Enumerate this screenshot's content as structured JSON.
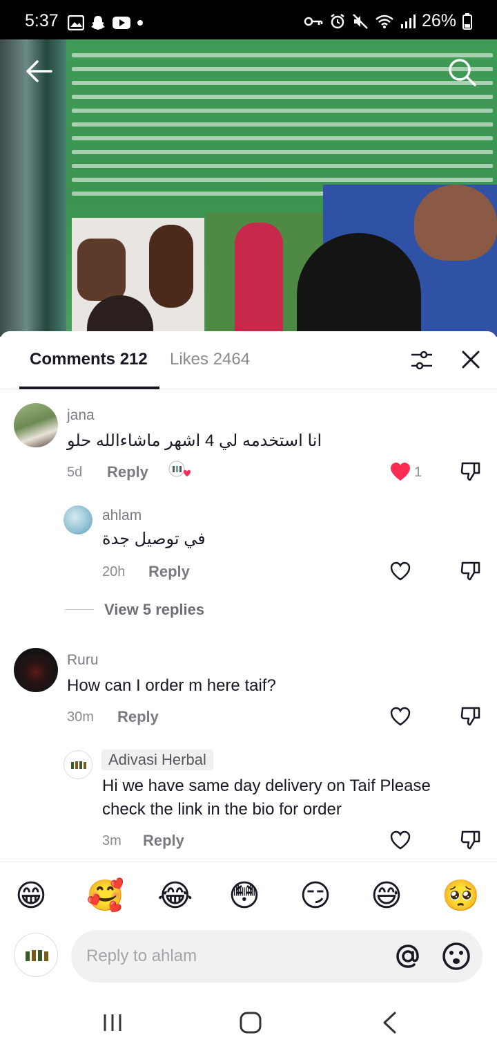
{
  "status_bar": {
    "time": "5:37",
    "battery": "26%"
  },
  "video": {
    "back_icon": "arrow-left-icon",
    "search_icon": "search-icon"
  },
  "tabs": {
    "comments_label": "Comments 212",
    "likes_label": "Likes 2464"
  },
  "comments": [
    {
      "username": "jana",
      "text": "انا استخدمه لي 4 اشهر ماشاءالله حلو",
      "time": "5d",
      "reply_label": "Reply",
      "like_count": "1",
      "liked": true,
      "liked_by_creator": true
    },
    {
      "username": "ahlam",
      "text": "في توصيل جدة",
      "time": "20h",
      "reply_label": "Reply",
      "liked": false,
      "is_reply": true
    },
    {
      "view_replies": "View 5 replies"
    },
    {
      "username": "Ruru",
      "text": "How can I order m here taif?",
      "time": "30m",
      "reply_label": "Reply",
      "liked": false
    },
    {
      "username": "Adivasi Herbal",
      "text": "Hi we have same day delivery on Taif Please check the link in the bio for order",
      "time": "3m",
      "reply_label": "Reply",
      "liked": false,
      "is_reply": true,
      "is_creator": true
    }
  ],
  "emojis": [
    "😁",
    "🥰",
    "😂",
    "😳",
    "😏",
    "😅",
    "🥺"
  ],
  "composer": {
    "placeholder": "Reply to ahlam"
  },
  "colors": {
    "accent_red": "#fe2c55",
    "text_primary": "#161823",
    "text_secondary": "#8a8b91"
  }
}
